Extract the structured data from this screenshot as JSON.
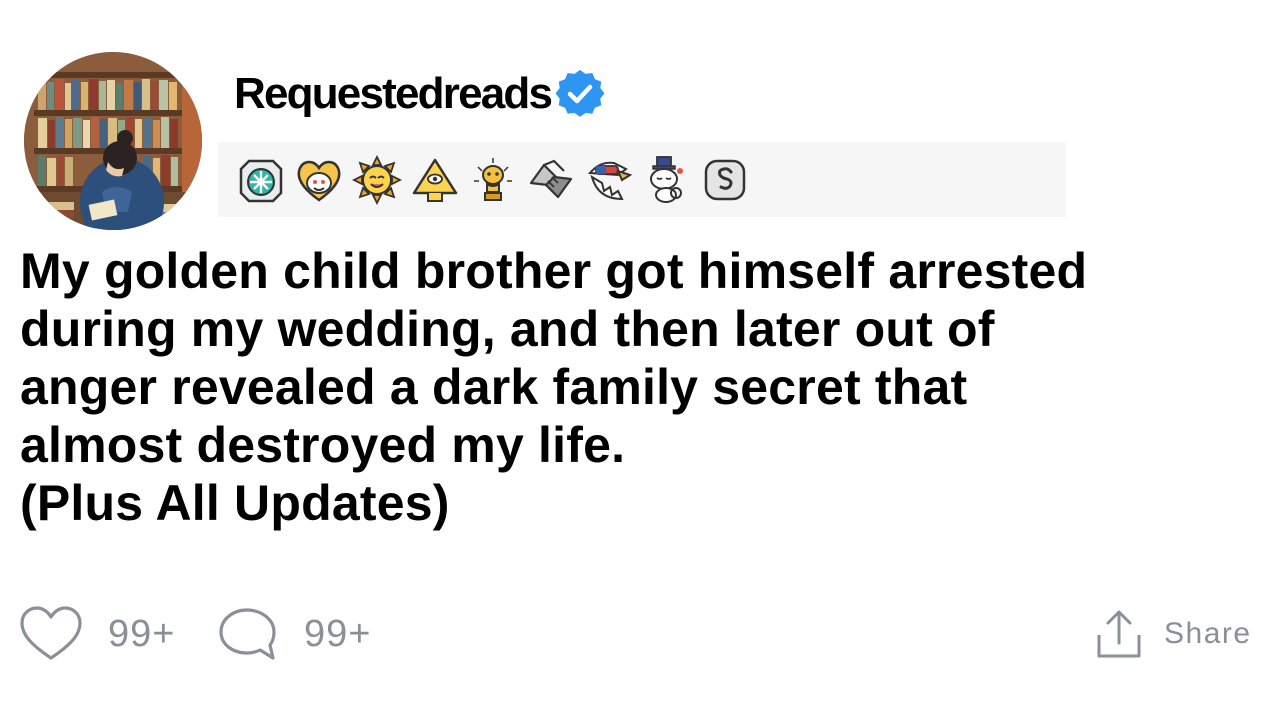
{
  "post": {
    "username": "Requestedreads",
    "verified": true,
    "title_lines": [
      "My golden child brother got himself arrested",
      "during my wedding, and then later out of",
      "anger revealed a dark family secret that",
      "almost destroyed my life.",
      "(Plus All Updates)"
    ]
  },
  "awards": [
    "helpful-award-icon",
    "wholesome-award-icon",
    "sun-smile-award-icon",
    "all-seeing-pyramid-award-icon",
    "gold-trophy-award-icon",
    "handshake-award-icon",
    "patriot-eagle-award-icon",
    "fancy-snoo-award-icon",
    "silver-coin-award-icon"
  ],
  "footer": {
    "likes": "99+",
    "comments": "99+",
    "share_label": "Share"
  },
  "colors": {
    "verified_badge": "#2f95f2",
    "muted_text": "#8a8f98",
    "award_strip_bg": "#f6f6f6"
  }
}
